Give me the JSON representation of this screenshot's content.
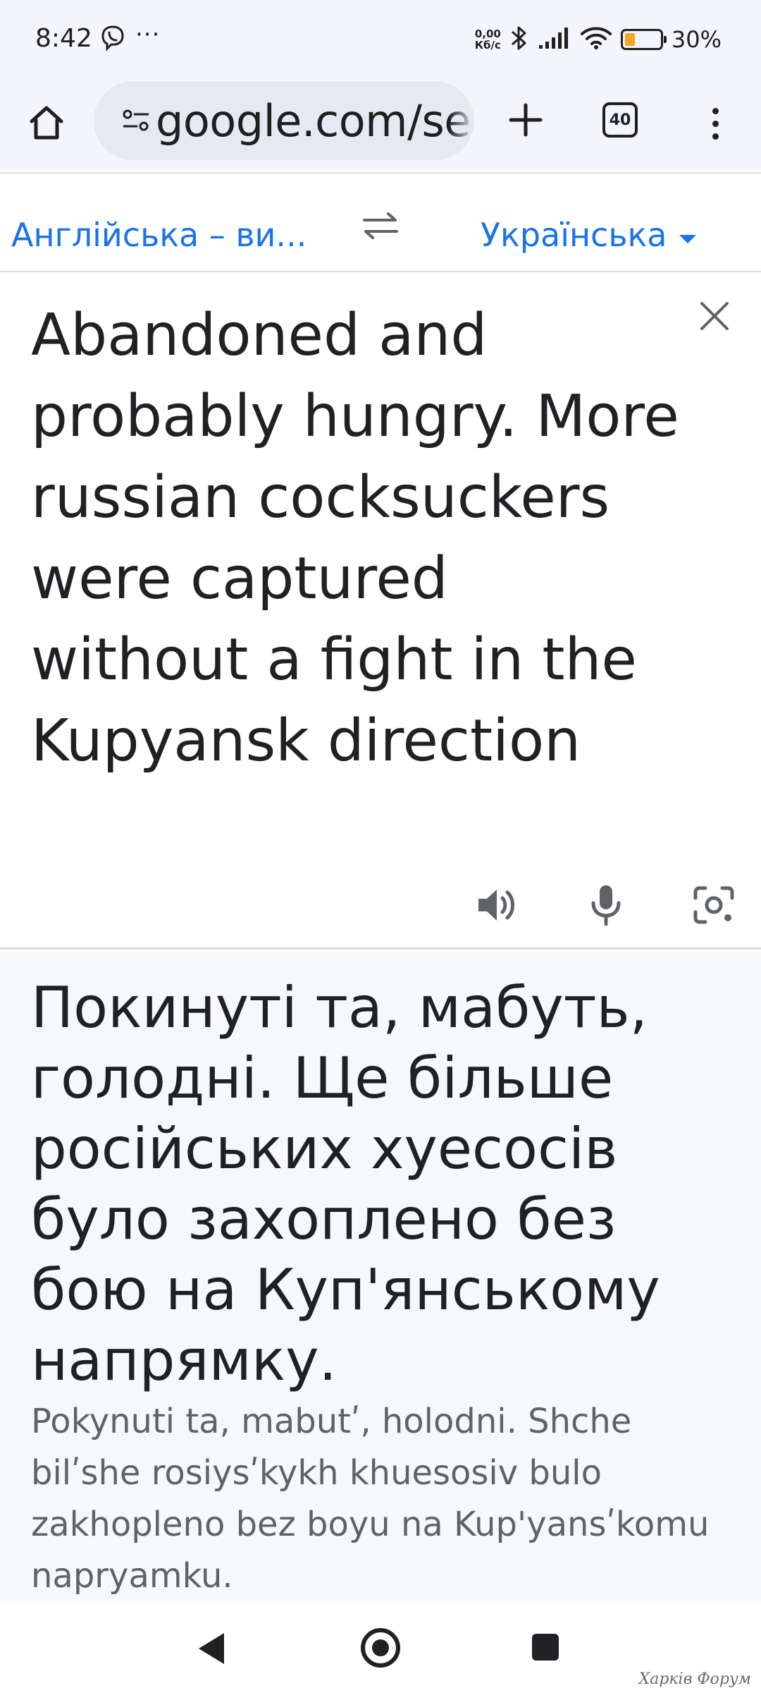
{
  "status_bar": {
    "time": "8:42",
    "net_speed_value": "0,00",
    "net_speed_unit": "Кб/с",
    "battery_percent": "30%",
    "battery_level": 0.3,
    "icons": [
      "viber-icon",
      "more-dots-icon",
      "bluetooth-icon",
      "signal-icon",
      "wifi-icon",
      "battery-icon"
    ]
  },
  "browser": {
    "url": "google.com/search",
    "tab_count": "40"
  },
  "translate": {
    "source_language": "Англійська – ви...",
    "target_language": "Українська",
    "source_text": "Abandoned and probably hungry. More russian cocksuckers were captured without a fight in the Kupyansk direction",
    "translation": "Покинуті та, мабуть, голодні. Ще більше російських хуесосів було захоплено без бою на Куп'янському напрямку.",
    "transliteration": "Pokynuti ta, mabutʹ, holodni. Shche bilʹshe rosiysʹkykh khuesosiv bulo zakhopleno bez boyu na Kup'yansʹkomu napryamku."
  },
  "watermark": "Харків Форум",
  "colors": {
    "accent": "#1a73e8",
    "battery_fill": "#f5a623",
    "chrome_bg": "#f3f5fb",
    "translation_bg": "#f7f8fb"
  }
}
